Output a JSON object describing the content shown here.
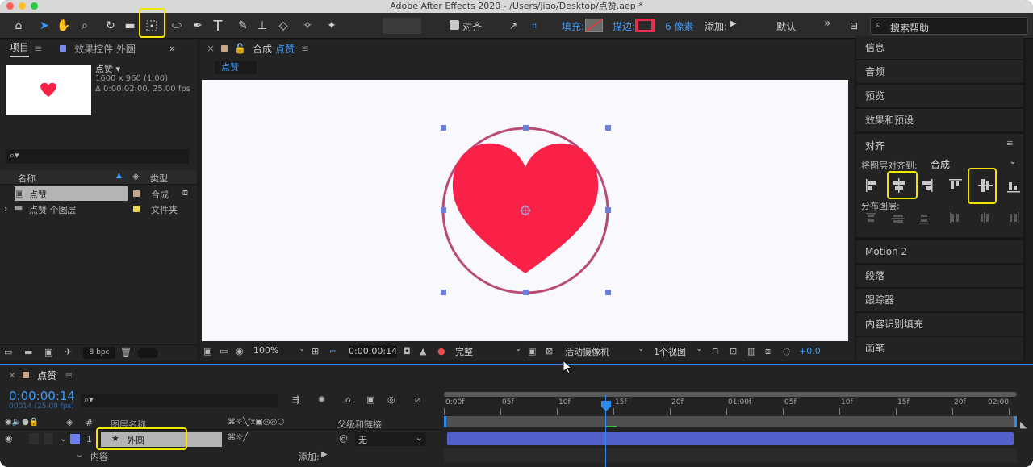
{
  "window": {
    "title": "Adobe After Effects 2020 - /Users/jiao/Desktop/点赞.aep *"
  },
  "toolbar": {
    "align_checkbox": "对齐",
    "fill_label": "填充:",
    "stroke_label": "描边:",
    "stroke_value": "6 像素",
    "add_label": "添加:",
    "workspace": "默认",
    "more": "»",
    "search_placeholder": "搜索帮助"
  },
  "project_panel": {
    "tab_project": "项目",
    "tab_effects": "效果控件 外圆",
    "comp_name": "点赞 ▾",
    "comp_size": "1600 x 960 (1.00)",
    "comp_duration": "Δ 0:00:02:00, 25.00 fps",
    "col_name": "名称",
    "col_type": "类型",
    "items": [
      {
        "name": "点赞",
        "type": "合成"
      },
      {
        "name": "点赞 个图层",
        "type": "文件夹"
      }
    ],
    "bpc": "8 bpc"
  },
  "comp_panel": {
    "tab": "合成 点赞",
    "tab_prefix": "合成",
    "tab_name": "点赞",
    "flow_tab": "点赞",
    "zoom": "100%",
    "timecode": "0:00:00:14",
    "resolution": "完整",
    "camera": "活动摄像机",
    "views": "1个视图",
    "exposure": "+0.0"
  },
  "right_panels": {
    "items_top": [
      "信息",
      "音频",
      "预览",
      "效果和预设"
    ],
    "align_title": "对齐",
    "align_to_label": "将图层对齐到:",
    "align_to_value": "合成",
    "distribute_label": "分布图层:",
    "items_bottom": [
      "Motion 2",
      "段落",
      "跟踪器",
      "内容识别填充",
      "画笔"
    ]
  },
  "timeline": {
    "tab": "点赞",
    "timecode": "0:00:00:14",
    "frame_info": "00014 (25.00 fps)",
    "col_layer_name": "图层名称",
    "col_parent": "父级和链接",
    "layer_index": "1",
    "layer_name": "外圆",
    "parent_value": "无",
    "contents_label": "内容",
    "add_label": "添加:",
    "ruler": [
      "0:00f",
      "05f",
      "10f",
      "15f",
      "20f",
      "01:00f",
      "05f",
      "10f",
      "15f",
      "20f",
      "02:00"
    ]
  },
  "colors": {
    "heart": "#fa2148",
    "circle": "#b94a78",
    "accent": "#2d8ceb",
    "highlight": "#f5e400",
    "layer_bar": "#5161c9"
  }
}
